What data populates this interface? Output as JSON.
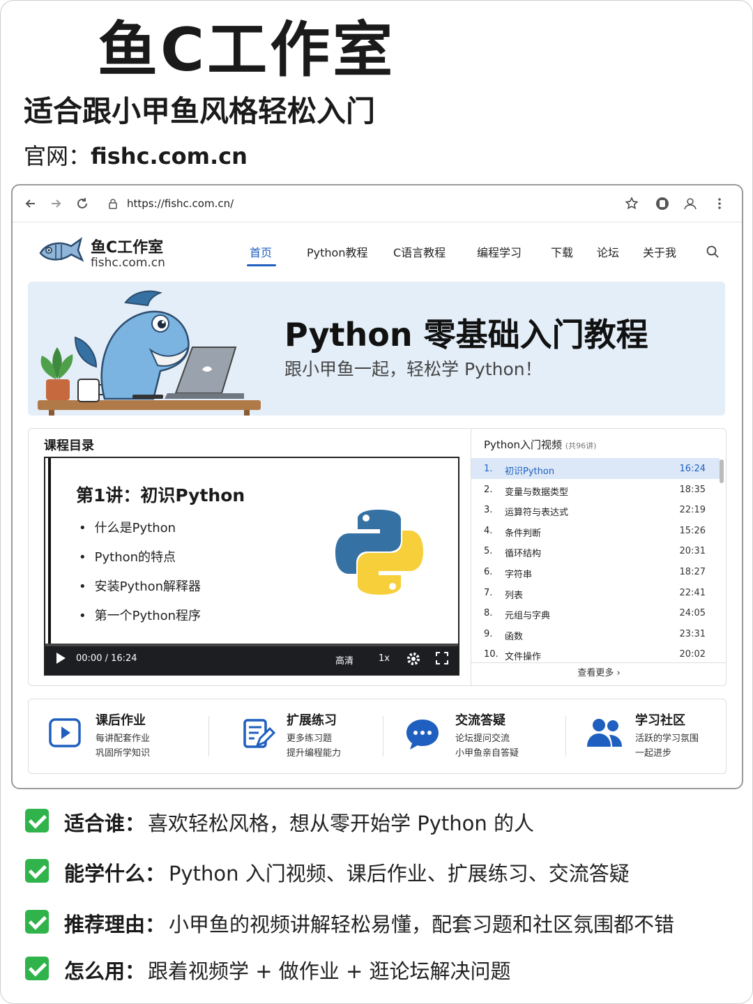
{
  "header": {
    "title": "鱼C工作室",
    "subtitle": "适合跟小甲鱼风格轻松入门",
    "site_label": "官网：",
    "site_url": "fishc.com.cn"
  },
  "browser": {
    "url": "https://fishc.com.cn/"
  },
  "site": {
    "brand": "鱼C工作室",
    "brand_url": "fishc.com.cn",
    "menu": [
      "首页",
      "Python教程",
      "C语言教程",
      "编程学习",
      "下载",
      "论坛",
      "关于我"
    ],
    "active_menu": "首页"
  },
  "banner": {
    "title": "Python 零基础入门教程",
    "subtitle": "跟小甲鱼一起，轻松学 Python！"
  },
  "course": {
    "section_title": "课程目录",
    "lesson_title": "第1讲：初识Python",
    "bullets": [
      "什么是Python",
      "Python的特点",
      "安装Python解释器",
      "第一个Python程序"
    ],
    "player": {
      "time": "00:00 / 16:24",
      "quality": "高清",
      "speed": "1x"
    }
  },
  "playlist": {
    "title": "Python入门视频",
    "count": "(共96讲)",
    "items": [
      {
        "n": "1.",
        "title": "初识Python",
        "duration": "16:24"
      },
      {
        "n": "2.",
        "title": "变量与数据类型",
        "duration": "18:35"
      },
      {
        "n": "3.",
        "title": "运算符与表达式",
        "duration": "22:19"
      },
      {
        "n": "4.",
        "title": "条件判断",
        "duration": "15:26"
      },
      {
        "n": "5.",
        "title": "循环结构",
        "duration": "20:31"
      },
      {
        "n": "6.",
        "title": "字符串",
        "duration": "18:27"
      },
      {
        "n": "7.",
        "title": "列表",
        "duration": "22:41"
      },
      {
        "n": "8.",
        "title": "元组与字典",
        "duration": "24:05"
      },
      {
        "n": "9.",
        "title": "函数",
        "duration": "23:31"
      },
      {
        "n": "10.",
        "title": "文件操作",
        "duration": "20:02"
      }
    ],
    "more": "查看更多 ›"
  },
  "features": [
    {
      "title": "课后作业",
      "line1": "每讲配套作业",
      "line2": "巩固所学知识",
      "icon": "play-icon"
    },
    {
      "title": "扩展练习",
      "line1": "更多练习题",
      "line2": "提升编程能力",
      "icon": "edit-note-icon"
    },
    {
      "title": "交流答疑",
      "line1": "论坛提问交流",
      "line2": "小甲鱼亲自答疑",
      "icon": "chat-icon"
    },
    {
      "title": "学习社区",
      "line1": "活跃的学习氛围",
      "line2": "一起进步",
      "icon": "users-icon"
    }
  ],
  "checks": [
    {
      "label": "适合谁：",
      "text": "喜欢轻松风格，想从零开始学 Python 的人"
    },
    {
      "label": "能学什么：",
      "text": "Python 入门视频、课后作业、扩展练习、交流答疑"
    },
    {
      "label": "推荐理由：",
      "text": "小甲鱼的视频讲解轻松易懂，配套习题和社区氛围都不错"
    },
    {
      "label": "怎么用：",
      "text": "跟着视频学 + 做作业 + 逛论坛解决问题"
    }
  ],
  "colors": {
    "accent": "#1f5fbf",
    "check_green": "#2fb34a",
    "banner_bg": "#e4eef8",
    "python_blue": "#3571a3",
    "python_yellow": "#f6cf3a"
  }
}
